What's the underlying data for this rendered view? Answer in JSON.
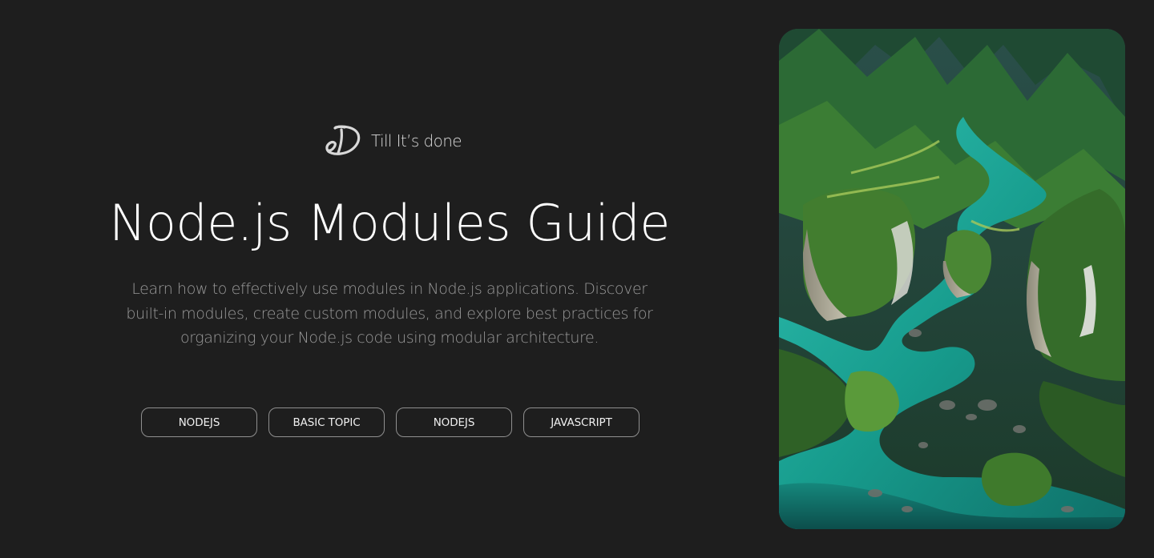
{
  "brand": {
    "name": "Till It’s done",
    "logo_icon": "stylized-d-logo-icon"
  },
  "hero": {
    "title": "Node.js Modules Guide",
    "description": "Learn how to effectively use modules in Node.js applications. Discover built-in modules, create custom modules, and explore best practices for organizing your Node.js code using modular architecture."
  },
  "tags": [
    {
      "label": "NODEJS"
    },
    {
      "label": "BASIC TOPIC"
    },
    {
      "label": "NODEJS"
    },
    {
      "label": "JAVASCRIPT"
    }
  ],
  "image": {
    "subject": "aerial-landscape-illustration",
    "colors": {
      "background": "#1e1e1e",
      "river": "#1aa596",
      "forest": "#2f5a28",
      "cliff": "#a09a88"
    }
  }
}
